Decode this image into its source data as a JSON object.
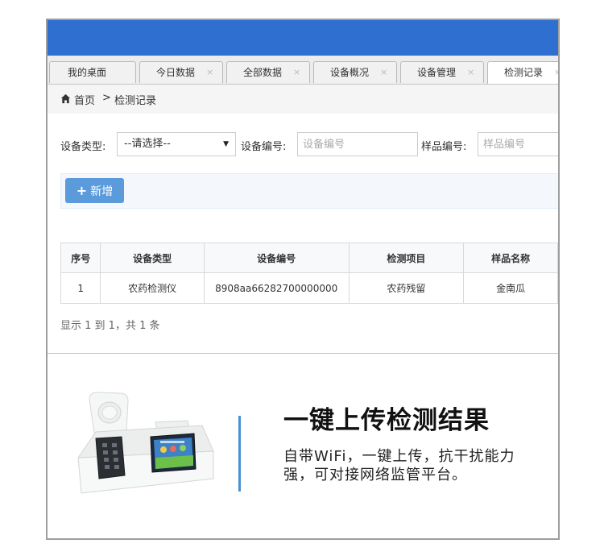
{
  "tabs": [
    {
      "label": "我的桌面",
      "closable": false,
      "active": false
    },
    {
      "label": "今日数据",
      "closable": true,
      "active": false
    },
    {
      "label": "全部数据",
      "closable": true,
      "active": false
    },
    {
      "label": "设备概况",
      "closable": true,
      "active": false
    },
    {
      "label": "设备管理",
      "closable": true,
      "active": false
    },
    {
      "label": "检测记录",
      "closable": true,
      "active": true
    }
  ],
  "tab_close_glyph": "×",
  "breadcrumb": {
    "home": "首页",
    "separator": ">",
    "current": "检测记录",
    "icon": "home-icon"
  },
  "filters": {
    "device_type_label": "设备类型:",
    "device_type_value": "--请选择--",
    "device_no_label": "设备编号:",
    "device_no_placeholder": "设备编号",
    "sample_no_label": "样品编号:",
    "sample_no_placeholder": "样品编号"
  },
  "toolbar": {
    "add_label": "新增",
    "add_icon": "plus-icon"
  },
  "table": {
    "headers": [
      "序号",
      "设备类型",
      "设备编号",
      "检测项目",
      "样品名称"
    ],
    "rows": [
      [
        "1",
        "农药检测仪",
        "8908aa66282700000000",
        "农药残留",
        "金南瓜"
      ]
    ]
  },
  "pager_text": "显示 1 到 1，共 1 条",
  "promo": {
    "title": "一键上传检测结果",
    "description": "自带WiFi，一键上传，抗干扰能力强，可对接网络监管平台。"
  },
  "colors": {
    "accent": "#2f6fd0",
    "button": "#5b9bdc",
    "divider_line": "#4a90d6"
  }
}
